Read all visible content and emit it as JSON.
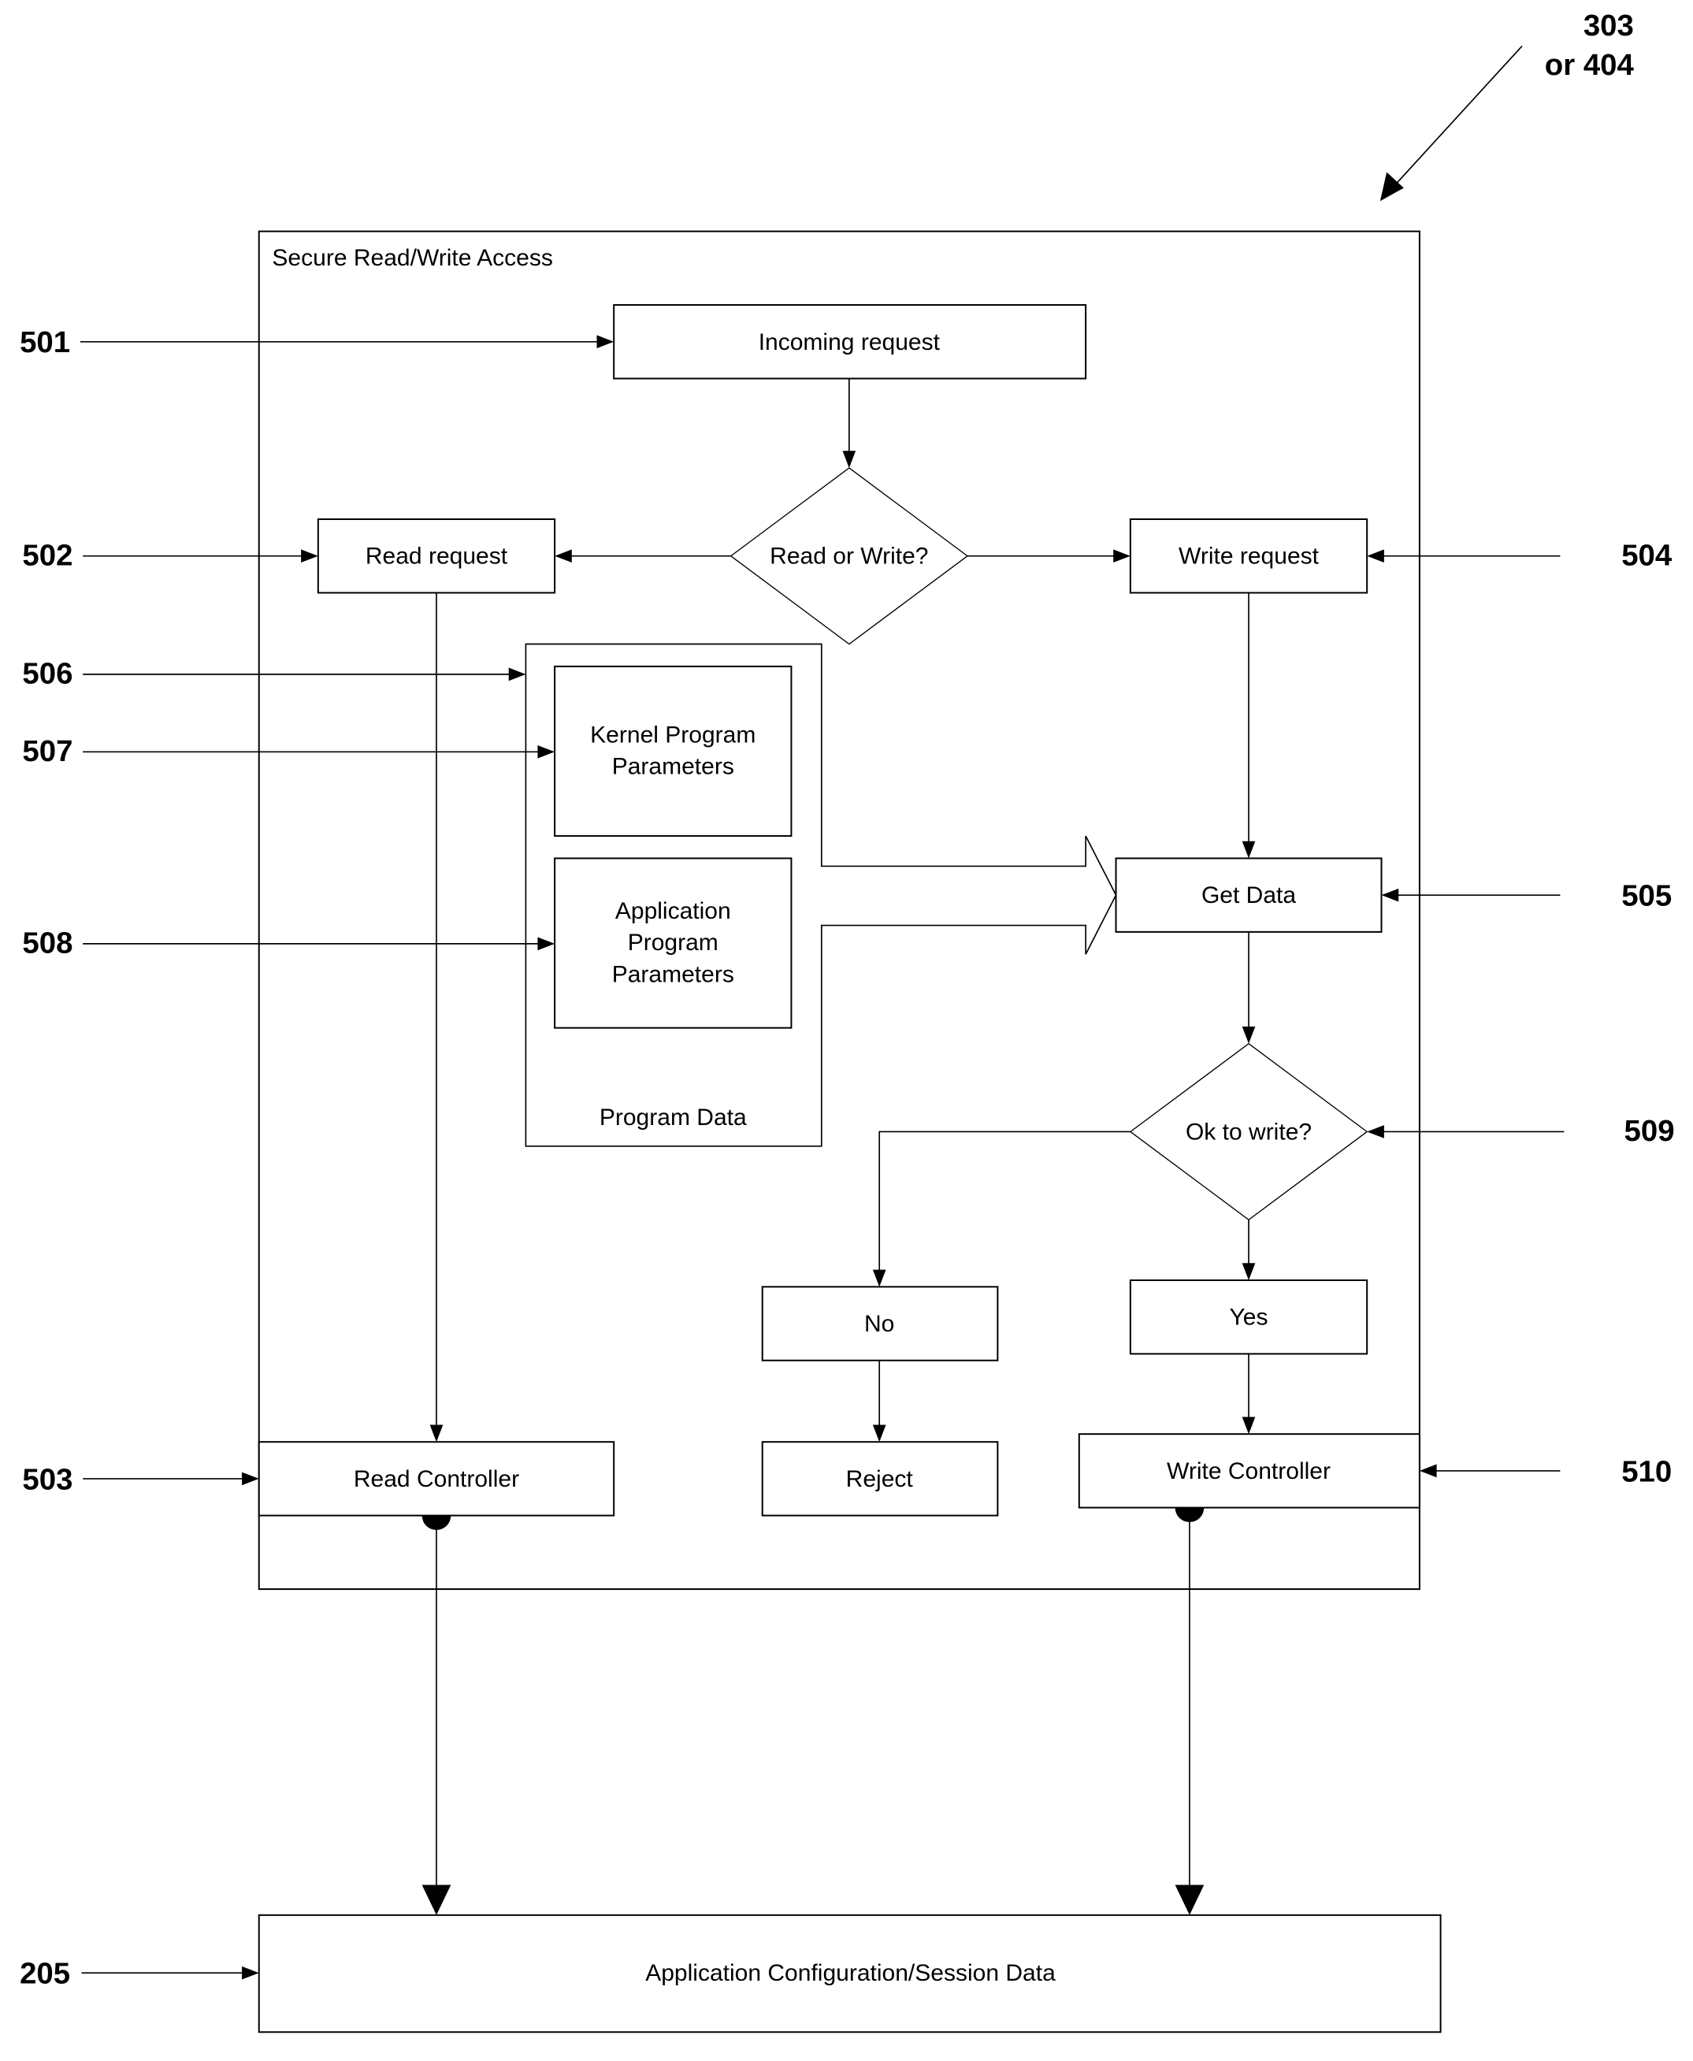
{
  "figure": {
    "pointer_label": [
      "303",
      "or 404"
    ],
    "container_title": "Secure Read/Write Access",
    "nodes": {
      "incoming_request": "Incoming request",
      "read_or_write": "Read or Write?",
      "read_request": "Read request",
      "write_request": "Write request",
      "kernel_params": [
        "Kernel Program",
        "Parameters"
      ],
      "application_params": [
        "Application",
        "Program",
        "Parameters"
      ],
      "program_data": "Program Data",
      "get_data": "Get Data",
      "ok_to_write": "Ok to write?",
      "no": "No",
      "yes": "Yes",
      "reject": "Reject",
      "read_controller": "Read Controller",
      "write_controller": "Write Controller",
      "app_config": "Application Configuration/Session Data"
    },
    "reference_numerals": {
      "r501": "501",
      "r502": "502",
      "r503": "503",
      "r504": "504",
      "r505": "505",
      "r506": "506",
      "r507": "507",
      "r508": "508",
      "r509": "509",
      "r510": "510",
      "r205": "205"
    }
  }
}
